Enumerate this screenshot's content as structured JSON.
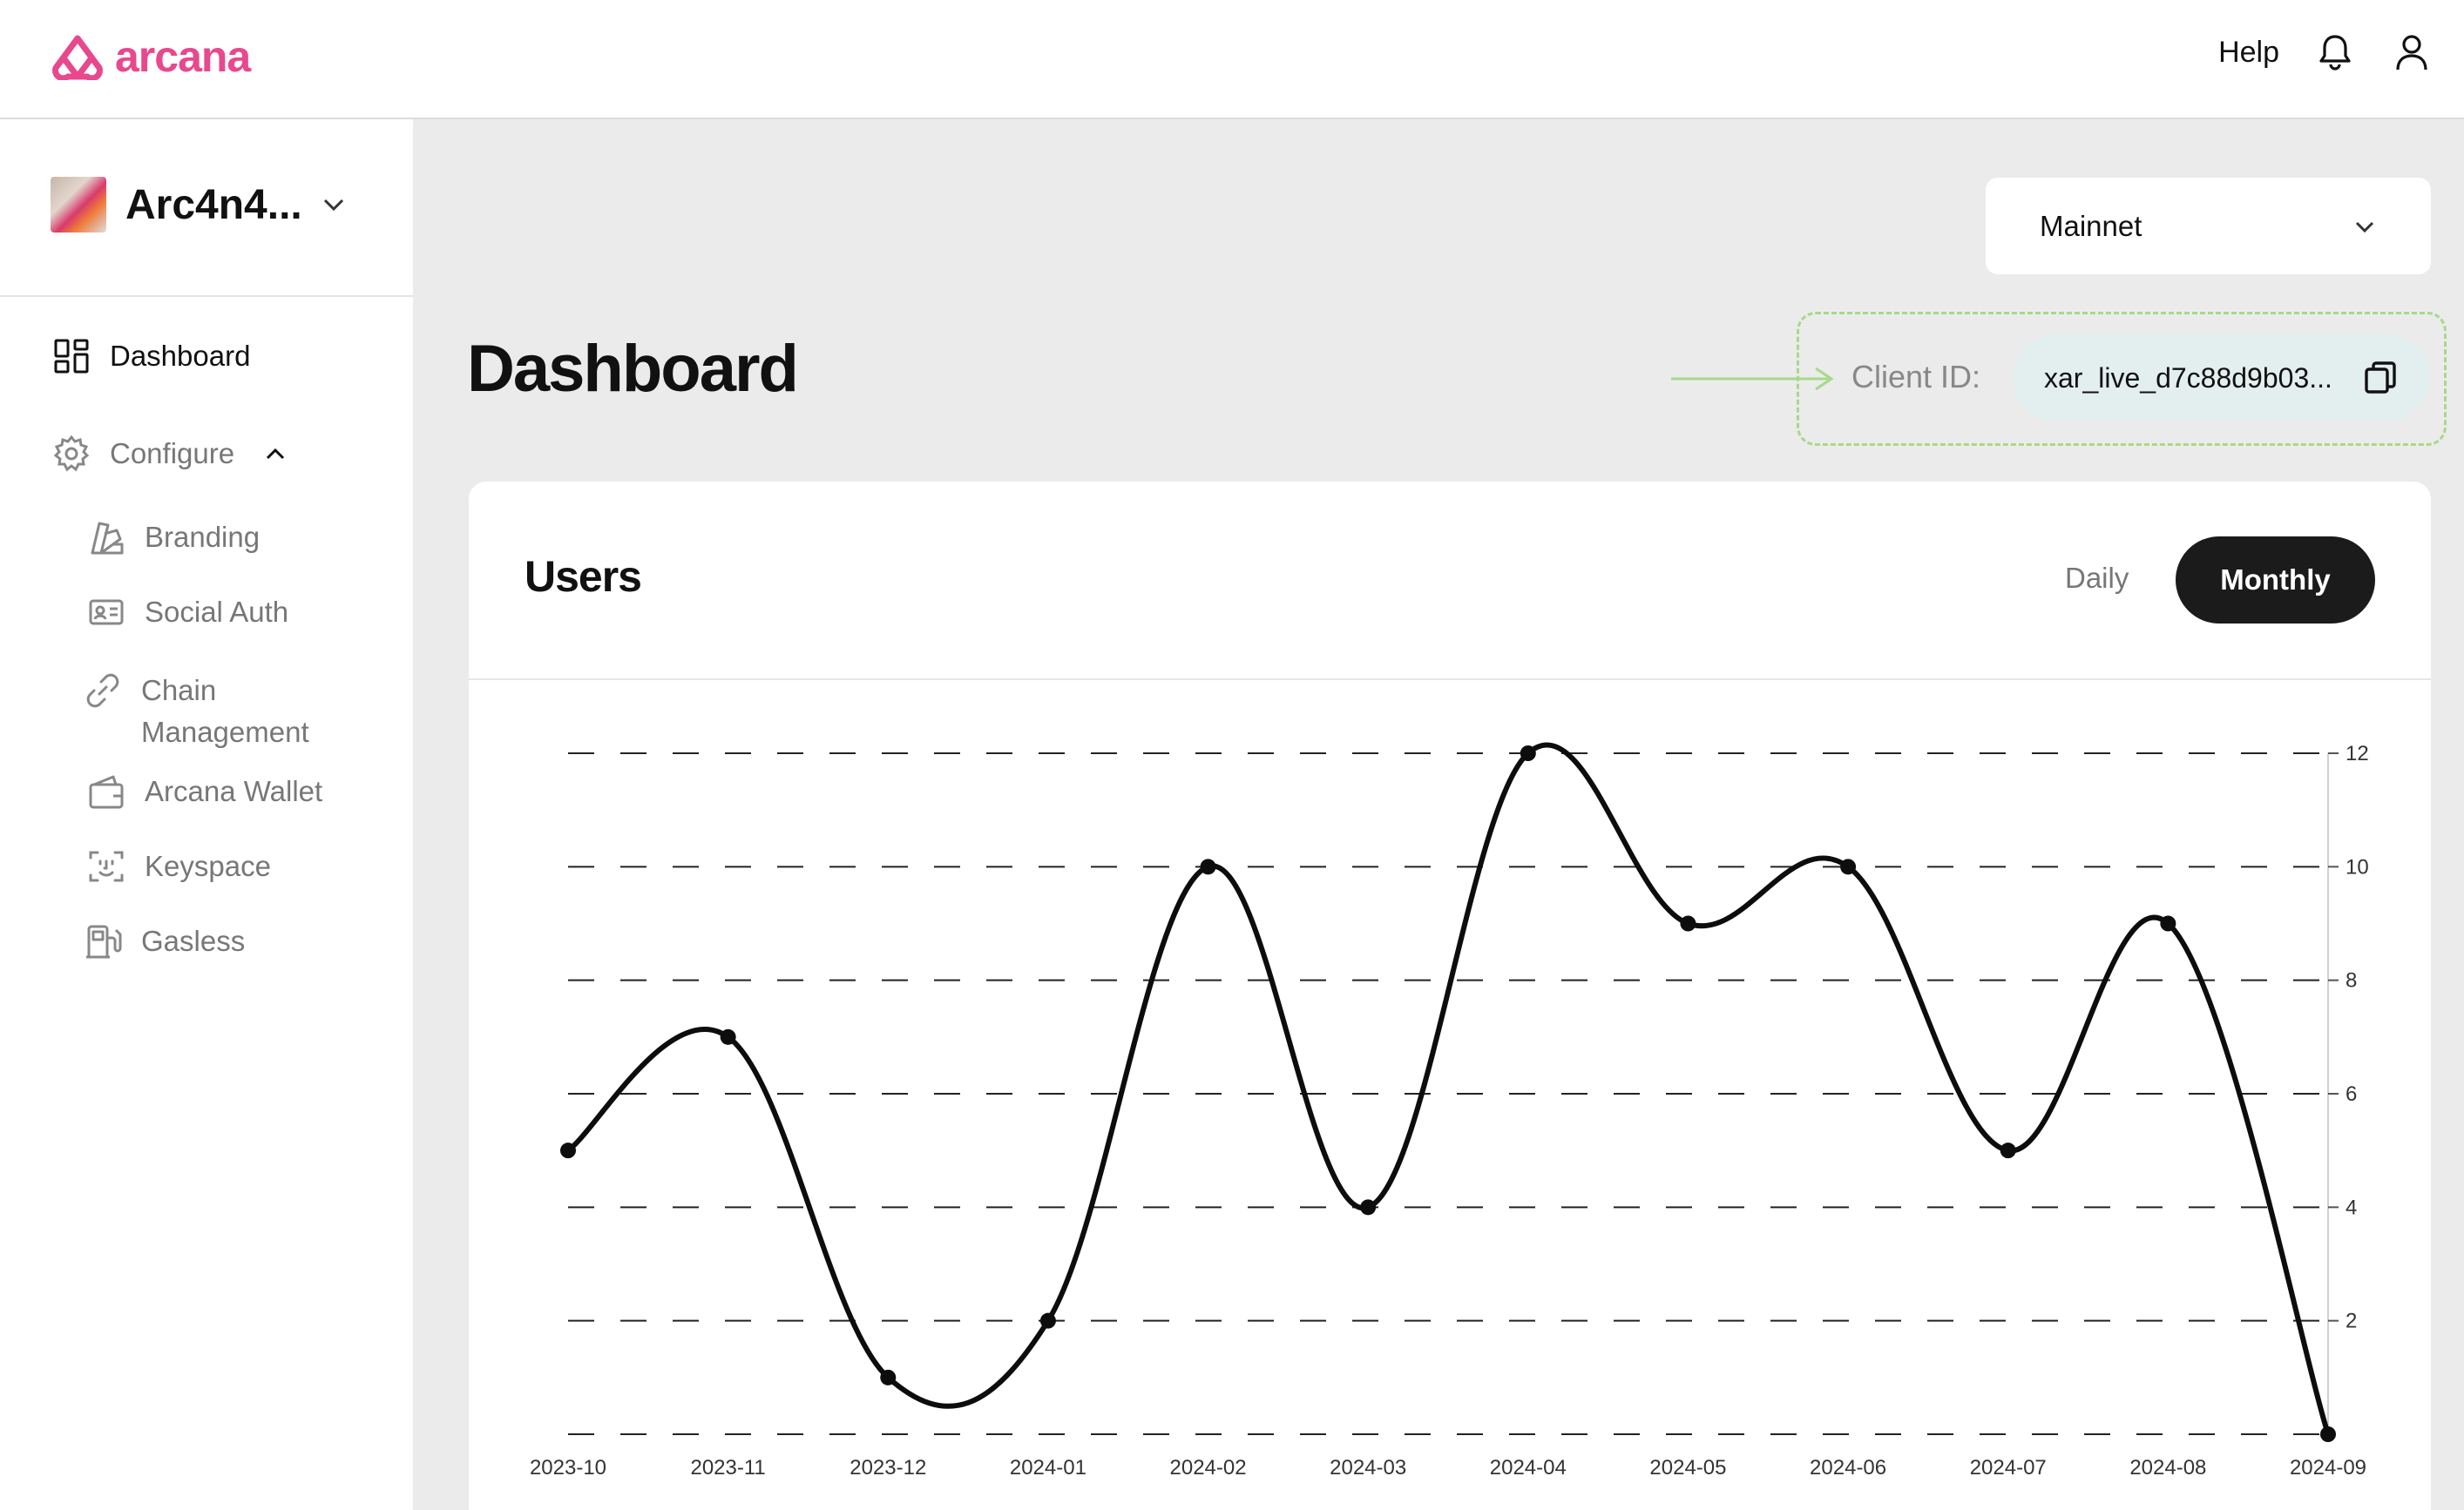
{
  "header": {
    "logo_text": "arcana",
    "help_label": "Help",
    "icons": [
      "bell-icon",
      "user-icon"
    ]
  },
  "sidebar": {
    "app_name": "Arc4n4...",
    "items": [
      {
        "label": "Dashboard",
        "icon": "dashboard-grid-icon",
        "active": true
      },
      {
        "label": "Configure",
        "icon": "gear-icon",
        "expanded": true
      },
      {
        "label": "Branding",
        "icon": "palette-icon"
      },
      {
        "label": "Social Auth",
        "icon": "id-card-icon"
      },
      {
        "label_line1": "Chain",
        "label_line2": "Management",
        "icon": "link-icon"
      },
      {
        "label": "Arcana Wallet",
        "icon": "wallet-icon"
      },
      {
        "label": "Keyspace",
        "icon": "face-scan-icon"
      },
      {
        "label": "Gasless",
        "icon": "fuel-pump-icon"
      }
    ]
  },
  "main": {
    "network": "Mainnet",
    "title": "Dashboard",
    "client_id_label": "Client ID:",
    "client_id_value": "xar_live_d7c88d9b03...",
    "card": {
      "title": "Users",
      "toggle_daily": "Daily",
      "toggle_monthly": "Monthly",
      "selected": "Monthly"
    }
  },
  "colors": {
    "brand": "#e8488e",
    "background": "#ebebeb",
    "highlight_dashed": "#a6d98a",
    "client_pill": "#e3eeee",
    "toggle_active": "#1b1b1b"
  },
  "chart_data": {
    "type": "line",
    "title": "Users",
    "categories": [
      "2023-10",
      "2023-11",
      "2023-12",
      "2024-01",
      "2024-02",
      "2024-03",
      "2024-04",
      "2024-05",
      "2024-06",
      "2024-07",
      "2024-08",
      "2024-09"
    ],
    "series": [
      {
        "values": [
          5,
          7,
          1,
          2,
          10,
          4,
          12,
          9,
          10,
          5,
          9,
          0
        ]
      }
    ],
    "y_ticks": [
      2,
      4,
      6,
      8,
      10,
      12
    ],
    "ylim": [
      0,
      12
    ],
    "y_axis_side": "right",
    "grid": "dashed horizontal",
    "xlabel": "",
    "ylabel": ""
  }
}
